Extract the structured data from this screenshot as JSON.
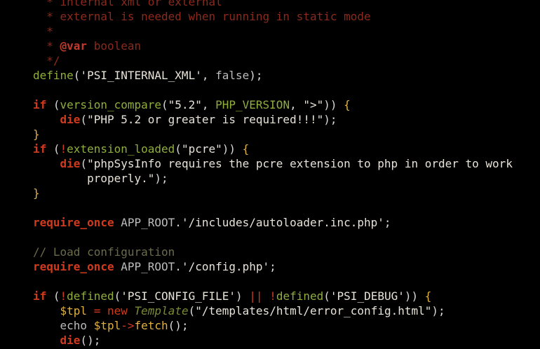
{
  "editor": {
    "language": "php",
    "lines": [
      [
        [
          "t-comment",
          "  * internal xml or external"
        ]
      ],
      [
        [
          "t-comment",
          "  * external is needed when running in static mode"
        ]
      ],
      [
        [
          "t-comment",
          "  *"
        ]
      ],
      [
        [
          "t-comment",
          "  * "
        ],
        [
          "t-doctag",
          "@var"
        ],
        [
          "t-comment",
          " boolean"
        ]
      ],
      [
        [
          "t-comment",
          "  */"
        ]
      ],
      [
        [
          "t-fn",
          "define"
        ],
        [
          "t-punct",
          "("
        ],
        [
          "t-str",
          "'PSI_INTERNAL_XML'"
        ],
        [
          "t-punct",
          ", "
        ],
        [
          "t-plain",
          "false"
        ],
        [
          "t-punct",
          ");"
        ]
      ],
      [],
      [
        [
          "t-kw",
          "if"
        ],
        [
          "t-punct",
          " ("
        ],
        [
          "t-fn",
          "version_compare"
        ],
        [
          "t-punct",
          "("
        ],
        [
          "t-str",
          "\"5.2\""
        ],
        [
          "t-punct",
          ", "
        ],
        [
          "t-const",
          "PHP_VERSION"
        ],
        [
          "t-punct",
          ", "
        ],
        [
          "t-str",
          "\">\""
        ],
        [
          "t-punct",
          ")) "
        ],
        [
          "t-brace",
          "{"
        ]
      ],
      [
        [
          "t-plain",
          "    "
        ],
        [
          "t-die",
          "die"
        ],
        [
          "t-punct",
          "("
        ],
        [
          "t-str",
          "\"PHP 5.2 or greater is required!!!\""
        ],
        [
          "t-punct",
          ");"
        ]
      ],
      [
        [
          "t-brace",
          "}"
        ]
      ],
      [
        [
          "t-kw",
          "if"
        ],
        [
          "t-punct",
          " ("
        ],
        [
          "t-op",
          "!"
        ],
        [
          "t-fn",
          "extension_loaded"
        ],
        [
          "t-punct",
          "("
        ],
        [
          "t-str",
          "\"pcre\""
        ],
        [
          "t-punct",
          ")) "
        ],
        [
          "t-brace",
          "{"
        ]
      ],
      [
        [
          "t-plain",
          "    "
        ],
        [
          "t-die",
          "die"
        ],
        [
          "t-punct",
          "("
        ],
        [
          "t-str",
          "\"phpSysInfo requires the pcre extension to php in order to work"
        ]
      ],
      [
        [
          "t-str",
          "        properly.\""
        ],
        [
          "t-punct",
          ");"
        ]
      ],
      [
        [
          "t-brace",
          "}"
        ]
      ],
      [],
      [
        [
          "t-kw",
          "require_once"
        ],
        [
          "t-plain",
          " APP_ROOT"
        ],
        [
          "t-punct",
          "."
        ],
        [
          "t-str",
          "'/includes/autoloader.inc.php'"
        ],
        [
          "t-punct",
          ";"
        ]
      ],
      [],
      [
        [
          "t-pcomment",
          "// Load configuration"
        ]
      ],
      [
        [
          "t-kw",
          "require_once"
        ],
        [
          "t-plain",
          " APP_ROOT"
        ],
        [
          "t-punct",
          "."
        ],
        [
          "t-str",
          "'/config.php'"
        ],
        [
          "t-punct",
          ";"
        ]
      ],
      [],
      [
        [
          "t-kw",
          "if"
        ],
        [
          "t-punct",
          " ("
        ],
        [
          "t-op",
          "!"
        ],
        [
          "t-fn",
          "defined"
        ],
        [
          "t-punct",
          "("
        ],
        [
          "t-str",
          "'PSI_CONFIG_FILE'"
        ],
        [
          "t-punct",
          ") "
        ],
        [
          "t-op",
          "||"
        ],
        [
          "t-punct",
          " "
        ],
        [
          "t-op",
          "!"
        ],
        [
          "t-fn",
          "defined"
        ],
        [
          "t-punct",
          "("
        ],
        [
          "t-str",
          "'PSI_DEBUG'"
        ],
        [
          "t-punct",
          ")) "
        ],
        [
          "t-brace",
          "{"
        ]
      ],
      [
        [
          "t-plain",
          "    "
        ],
        [
          "t-var",
          "$tpl"
        ],
        [
          "t-punct",
          " "
        ],
        [
          "t-op",
          "="
        ],
        [
          "t-punct",
          " "
        ],
        [
          "t-new",
          "new"
        ],
        [
          "t-punct",
          " "
        ],
        [
          "t-cls",
          "Template"
        ],
        [
          "t-punct",
          "("
        ],
        [
          "t-str",
          "\"/templates/html/error_config.html\""
        ],
        [
          "t-punct",
          ");"
        ]
      ],
      [
        [
          "t-plain",
          "    echo "
        ],
        [
          "t-var",
          "$tpl"
        ],
        [
          "t-op",
          "->"
        ],
        [
          "t-method",
          "fetch"
        ],
        [
          "t-punct",
          "();"
        ]
      ],
      [
        [
          "t-plain",
          "    "
        ],
        [
          "t-die",
          "die"
        ],
        [
          "t-punct",
          "();"
        ]
      ]
    ]
  }
}
